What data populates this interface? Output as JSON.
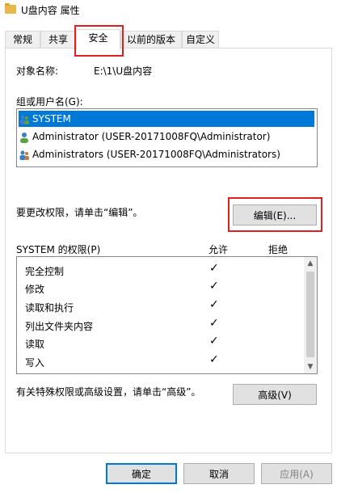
{
  "window": {
    "title": "U盘内容 属性"
  },
  "tabs": [
    {
      "label": "常规"
    },
    {
      "label": "共享"
    },
    {
      "label": "安全"
    },
    {
      "label": "以前的版本"
    },
    {
      "label": "自定义"
    }
  ],
  "security": {
    "object_label": "对象名称:",
    "object_value": "E:\\1\\U盘内容",
    "groups_label": "组或用户名(G):",
    "users": [
      {
        "name": "SYSTEM",
        "selected": true
      },
      {
        "name": "Administrator (USER-20171008FQ\\Administrator)",
        "selected": false
      },
      {
        "name": "Administrators (USER-20171008FQ\\Administrators)",
        "selected": false
      }
    ],
    "edit_hint": "要更改权限，请单击“编辑”。",
    "edit_button": "编辑(E)...",
    "perm_title": "SYSTEM 的权限(P)",
    "allow_header": "允许",
    "deny_header": "拒绝",
    "permissions": [
      {
        "name": "完全控制",
        "allow": true,
        "deny": false
      },
      {
        "name": "修改",
        "allow": true,
        "deny": false
      },
      {
        "name": "读取和执行",
        "allow": true,
        "deny": false
      },
      {
        "name": "列出文件夹内容",
        "allow": true,
        "deny": false
      },
      {
        "name": "读取",
        "allow": true,
        "deny": false
      },
      {
        "name": "写入",
        "allow": true,
        "deny": false
      }
    ],
    "check_glyph": "✓",
    "advanced_hint": "有关特殊权限或高级设置，请单击“高级”。",
    "advanced_button": "高级(V)"
  },
  "footer": {
    "ok": "确定",
    "cancel": "取消",
    "apply": "应用(A)"
  },
  "colors": {
    "highlight": "#0078d7",
    "annotation": "#e02020"
  }
}
